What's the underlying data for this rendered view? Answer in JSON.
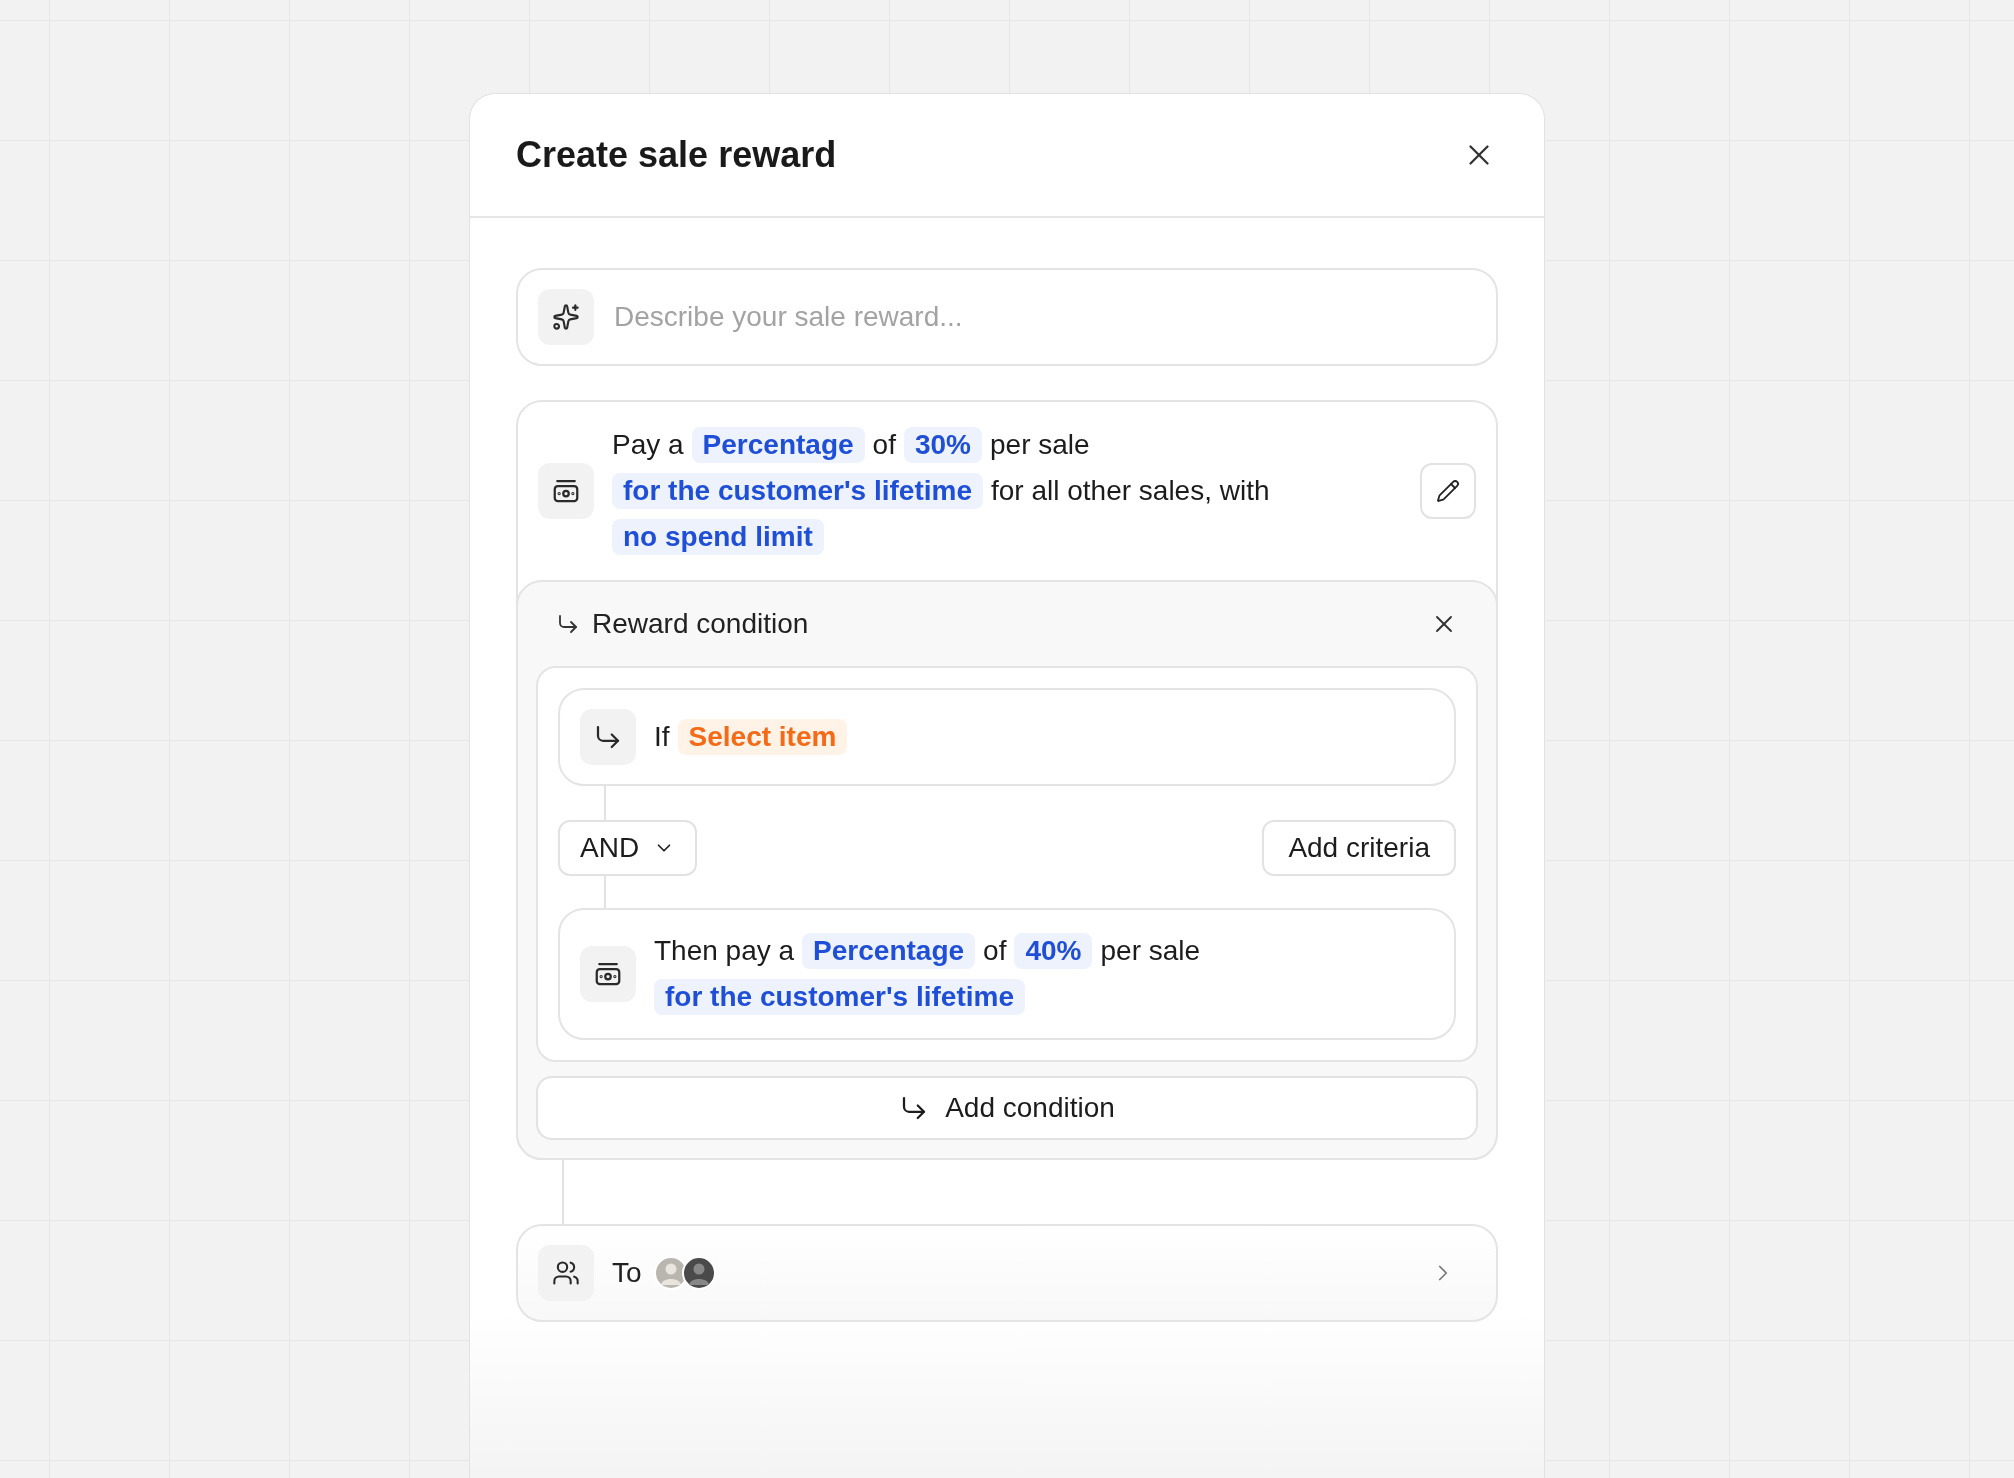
{
  "dialog": {
    "title": "Create sale reward"
  },
  "prompt": {
    "placeholder": "Describe your sale reward..."
  },
  "reward": {
    "lines": [
      [
        {
          "kind": "text",
          "text": "Pay a"
        },
        {
          "kind": "chip",
          "text": "Percentage"
        },
        {
          "kind": "text",
          "text": "of"
        },
        {
          "kind": "chip",
          "text": "30%"
        },
        {
          "kind": "text",
          "text": "per sale"
        }
      ],
      [
        {
          "kind": "chip",
          "text": "for the customer's lifetime"
        },
        {
          "kind": "text",
          "text": "for all other sales, with"
        }
      ],
      [
        {
          "kind": "chip",
          "text": "no spend limit"
        }
      ]
    ]
  },
  "condition": {
    "title": "Reward condition",
    "criteria": [
      {
        "kind": "text",
        "text": "If"
      },
      {
        "kind": "pick",
        "text": "Select item"
      }
    ],
    "operator": {
      "label": "AND"
    },
    "add_criteria": "Add criteria",
    "result": {
      "lines": [
        [
          {
            "kind": "text",
            "text": "Then pay a"
          },
          {
            "kind": "chip",
            "text": "Percentage"
          },
          {
            "kind": "text",
            "text": "of"
          },
          {
            "kind": "chip",
            "text": "40%"
          },
          {
            "kind": "text",
            "text": "per sale"
          }
        ],
        [
          {
            "kind": "chip",
            "text": "for the customer's lifetime"
          }
        ]
      ]
    },
    "add_condition": "Add condition"
  },
  "recipients": {
    "label": "To"
  }
}
